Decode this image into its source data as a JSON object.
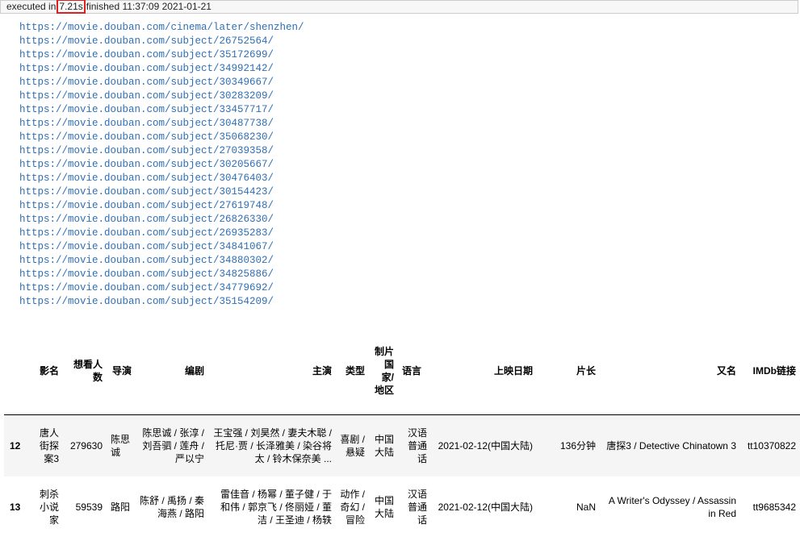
{
  "exec": {
    "prefix": "executed in",
    "duration": "7.21s",
    "suffix": "finished 11:37:09 2021-01-21"
  },
  "urls": [
    "https://movie.douban.com/cinema/later/shenzhen/",
    "https://movie.douban.com/subject/26752564/",
    "https://movie.douban.com/subject/35172699/",
    "https://movie.douban.com/subject/34992142/",
    "https://movie.douban.com/subject/30349667/",
    "https://movie.douban.com/subject/30283209/",
    "https://movie.douban.com/subject/33457717/",
    "https://movie.douban.com/subject/30487738/",
    "https://movie.douban.com/subject/35068230/",
    "https://movie.douban.com/subject/27039358/",
    "https://movie.douban.com/subject/30205667/",
    "https://movie.douban.com/subject/30476403/",
    "https://movie.douban.com/subject/30154423/",
    "https://movie.douban.com/subject/27619748/",
    "https://movie.douban.com/subject/26826330/",
    "https://movie.douban.com/subject/26935283/",
    "https://movie.douban.com/subject/34841067/",
    "https://movie.douban.com/subject/34880302/",
    "https://movie.douban.com/subject/34825886/",
    "https://movie.douban.com/subject/34779692/",
    "https://movie.douban.com/subject/35154209/"
  ],
  "table": {
    "columns": [
      "",
      "影名",
      "想看人数",
      "导演",
      "编剧",
      "主演",
      "类型",
      "制片国家/地区",
      "语言",
      "上映日期",
      "片长",
      "又名",
      "IMDb链接"
    ],
    "rows": [
      [
        "12",
        "唐人街探案3",
        "279630",
        "陈思诚",
        "陈思诚 / 张淳 / 刘吾驷 / 莲舟 / 严以宁",
        "王宝强 / 刘昊然 / 妻夫木聪 / 托尼·贾 / 长泽雅美 / 染谷将太 / 铃木保奈美 ...",
        "喜剧 / 悬疑",
        "中国大陆",
        "汉语普通话",
        "2021-02-12(中国大陆)",
        "136分钟",
        "唐探3 / Detective Chinatown 3",
        "tt10370822"
      ],
      [
        "13",
        "刺杀小说家",
        "59539",
        "路阳",
        "陈舒 / 禹扬 / 秦海燕 / 路阳",
        "雷佳音 / 杨幂 / 董子健 / 于和伟 / 郭京飞 / 佟丽娅 / 董洁 / 王圣迪 / 杨轶",
        "动作 / 奇幻 / 冒险",
        "中国大陆",
        "汉语普通话",
        "2021-02-12(中国大陆)",
        "NaN",
        "A Writer's Odyssey / Assassin in Red",
        "tt9685342"
      ]
    ]
  }
}
